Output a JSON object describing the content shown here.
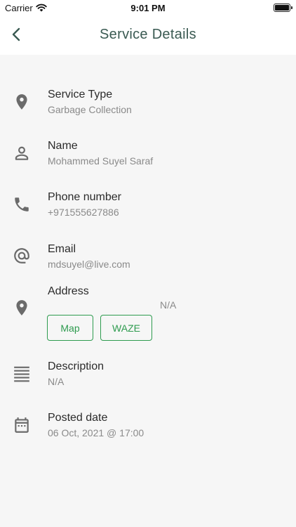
{
  "status_bar": {
    "carrier": "Carrier",
    "time": "9:01 PM"
  },
  "header": {
    "title": "Service Details"
  },
  "details": {
    "service_type": {
      "label": "Service Type",
      "value": "Garbage Collection",
      "icon": "location-pin-icon"
    },
    "name": {
      "label": "Name",
      "value": "Mohammed Suyel Saraf",
      "icon": "person-icon"
    },
    "phone": {
      "label": "Phone number",
      "value": "+971555627886",
      "icon": "phone-icon"
    },
    "email": {
      "label": "Email",
      "value": "mdsuyel@live.com",
      "icon": "at-icon"
    },
    "address": {
      "label": "Address",
      "value": "N/A",
      "icon": "location-pin-icon",
      "map_button": "Map",
      "waze_button": "WAZE"
    },
    "description": {
      "label": "Description",
      "value": "N/A",
      "icon": "lines-icon"
    },
    "posted_date": {
      "label": "Posted date",
      "value": "06 Oct, 2021 @ 17:00",
      "icon": "calendar-icon"
    }
  },
  "colors": {
    "title": "#3a5a52",
    "accent_green": "#2e9b4f",
    "icon_gray": "#6b6b6b",
    "background": "#f6f6f6"
  }
}
